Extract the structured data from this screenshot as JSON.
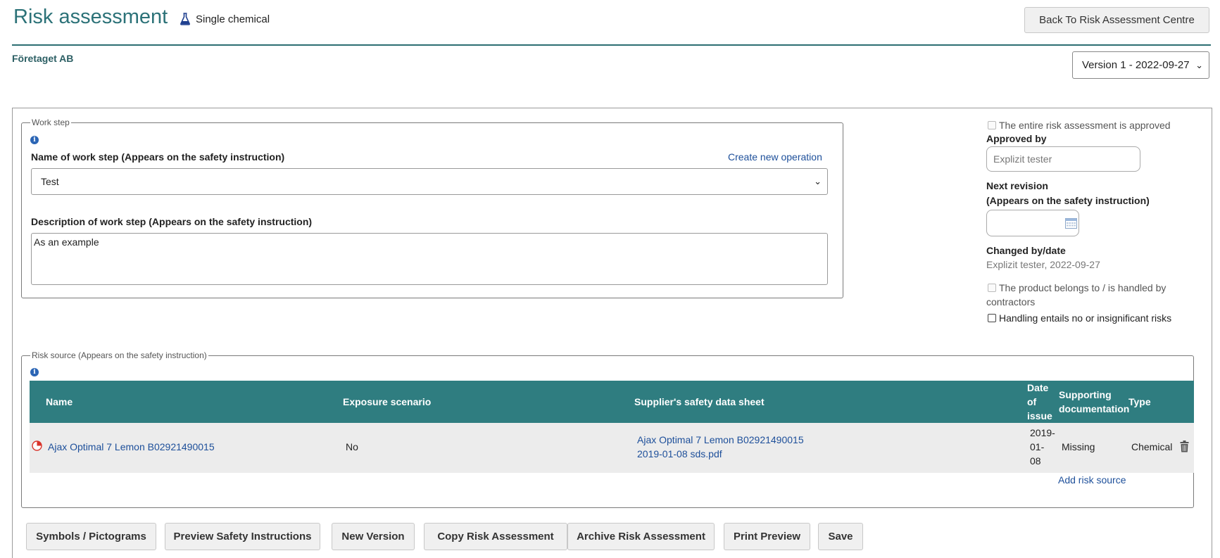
{
  "header": {
    "title": "Risk assessment",
    "subtitle": "Single chemical",
    "back_button": "Back To Risk Assessment Centre",
    "company": "Företaget AB",
    "version": "Version 1 - 2022-09-27",
    "accent_color": "#2c7278"
  },
  "work_step": {
    "legend": "Work step",
    "name_label": "Name of work step (Appears on the safety instruction)",
    "create_link": "Create new operation",
    "name_value": "Test",
    "desc_label": "Description of work step (Appears on the safety instruction)",
    "desc_value": "As an example"
  },
  "side": {
    "approved_check": "The entire risk assessment is approved",
    "approved_by_label": "Approved by",
    "approved_by_value": "Explizit tester",
    "next_revision_label": "Next revision",
    "next_revision_sub": "(Appears on the safety instruction)",
    "changed_label": "Changed by/date",
    "changed_value": "Explizit tester, 2022-09-27",
    "contractors_check_line1": "The product belongs to / is handled by",
    "contractors_check_line2": "contractors",
    "insignificant_check": "Handling entails no or insignificant risks"
  },
  "risk_source": {
    "legend": "Risk source (Appears on the safety instruction)",
    "columns": {
      "name": "Name",
      "exposure": "Exposure scenario",
      "sds": "Supplier's safety data sheet",
      "date_1": "Date",
      "date_2": "of",
      "date_3": "issue",
      "supporting_1": "Supporting",
      "supporting_2": "documentation",
      "type": "Type"
    },
    "rows": [
      {
        "name": "Ajax Optimal 7 Lemon B02921490015",
        "exposure": "No",
        "sds_1": "Ajax Optimal 7 Lemon B02921490015",
        "sds_2": "2019-01-08 sds.pdf",
        "date_1": "2019-",
        "date_2": "01-",
        "date_3": "08",
        "supporting": "Missing",
        "type": "Chemical"
      }
    ],
    "add_link": "Add risk source",
    "header_color": "#2f7d80"
  },
  "buttons": {
    "symbols": "Symbols / Pictograms",
    "preview": "Preview Safety Instructions",
    "new_version": "New Version",
    "copy": "Copy Risk Assessment",
    "archive": "Archive Risk Assessment",
    "print": "Print Preview",
    "save": "Save"
  }
}
